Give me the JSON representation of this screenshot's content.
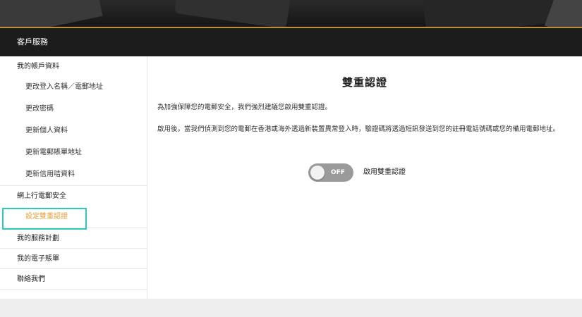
{
  "header": {
    "title": "客戶服務"
  },
  "sidebar": {
    "groups": [
      {
        "label": "我的帳戶資料",
        "items": [
          "更改登入名稱／電郵地址",
          "更改密碼",
          "更新個人資料",
          "更新電郵賬單地址",
          "更新信用咭資料"
        ]
      },
      {
        "label": "網上行電郵安全",
        "items": [
          "設定雙重認證"
        ]
      },
      {
        "label": "我的服務計劃",
        "items": []
      },
      {
        "label": "我的電子賬單",
        "items": []
      },
      {
        "label": "聯絡我們",
        "items": []
      }
    ],
    "active_item": "設定雙重認證",
    "accent_color": "#e6a23c",
    "highlight_color": "#2ec9b7"
  },
  "main": {
    "title": "雙重認證",
    "paragraph1": "為加強保障您的電郵安全，我們強烈建議您啟用雙重認證。",
    "paragraph2": "啟用後，當我們偵測到您的電郵在香港或海外透過新裝置異常登入時，驗證碼將透過短訊發送到您的註冊電話號碼或您的備用電郵地址。",
    "toggle": {
      "state_text": "OFF",
      "label": "啟用雙重認證"
    }
  }
}
